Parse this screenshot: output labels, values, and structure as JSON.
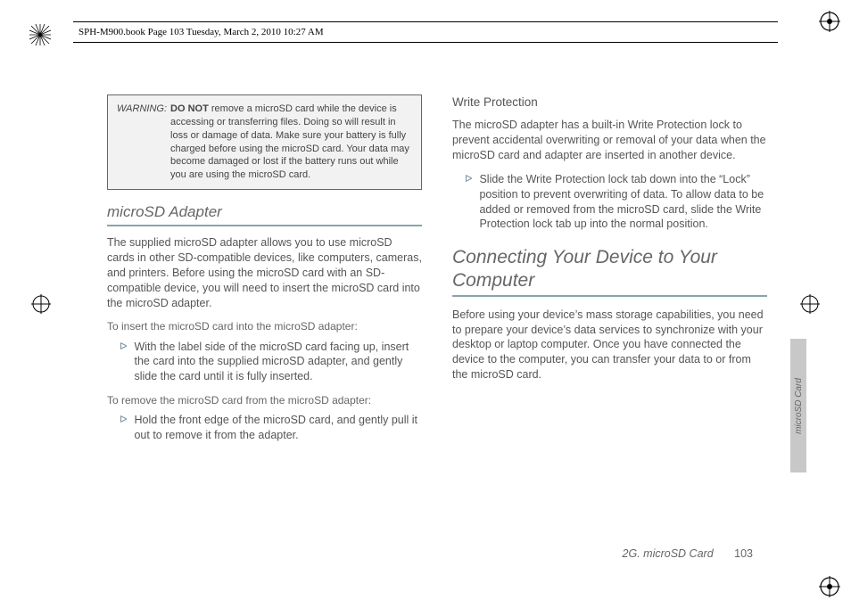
{
  "header": {
    "running": "SPH-M900.book  Page 103  Tuesday, March 2, 2010  10:27 AM"
  },
  "warning": {
    "label": "WARNING:",
    "bold": "DO NOT",
    "text_before": " remove a microSD card while the device is accessing or transferring files. Doing so will result in loss or damage of data. Make sure your battery is fully charged before using the microSD card. Your data may become damaged or lost if the battery runs out while you are using the microSD card."
  },
  "left": {
    "h3": "microSD Adapter",
    "p1": "The supplied microSD adapter allows you to use microSD cards in other SD-compatible devices, like computers, cameras, and printers. Before using the microSD card with an SD-compatible device, you will need to insert the microSD card into the microSD adapter.",
    "lead1": "To insert the microSD card into the microSD adapter:",
    "b1": "With the label side of the microSD card facing up, insert the card into the supplied microSD adapter, and gently slide the card until it is fully inserted.",
    "lead2": "To remove the microSD card from the microSD adapter:",
    "b2": "Hold the front edge of the microSD card, and gently pull it out to remove it from the adapter."
  },
  "right": {
    "h4": "Write Protection",
    "p1": "The microSD adapter has a built-in Write Protection lock to prevent accidental overwriting or removal of your data when the microSD card and adapter are inserted in another device.",
    "b1": "Slide the Write Protection lock tab down into the “Lock” position to prevent overwriting of data. To allow data to be added or removed from the microSD card, slide the Write Protection lock tab up into the normal position.",
    "h2": "Connecting Your Device to Your Computer",
    "p2": "Before using your device’s mass storage capabilities, you need to prepare your device’s data services to synchronize with your desktop or laptop computer. Once you have connected the device to the computer, you can transfer your data to or from the microSD card."
  },
  "sideTab": "microSD Card",
  "footer": {
    "section": "2G. microSD Card",
    "page": "103"
  }
}
